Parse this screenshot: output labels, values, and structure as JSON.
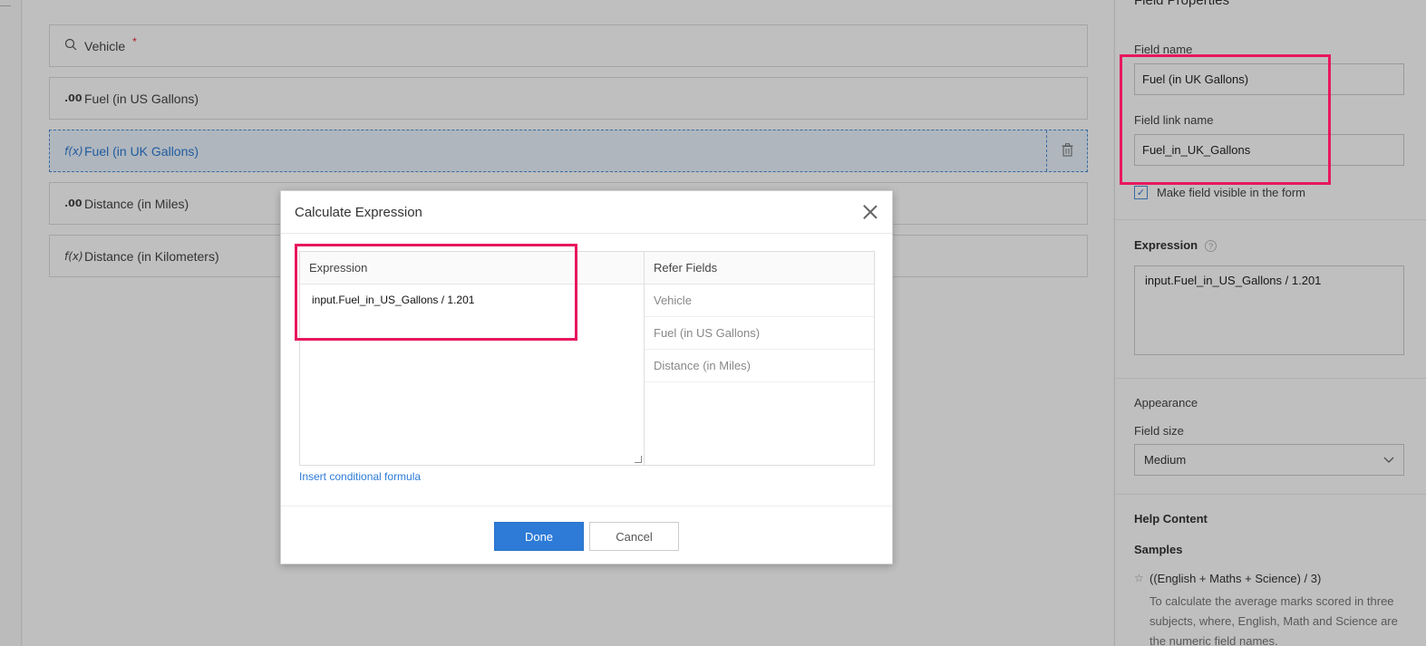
{
  "form_fields": [
    {
      "label": "Vehicle",
      "icon": "search-icon",
      "required_mark": "*"
    },
    {
      "label": "Fuel (in US Gallons)",
      "icon": "decimal-icon",
      "icon_text": ".00"
    },
    {
      "label": "Fuel (in UK Gallons)",
      "icon": "formula-icon",
      "icon_text": "f(x)",
      "selected": true
    },
    {
      "label": "Distance (in Miles)",
      "icon": "decimal-icon",
      "icon_text": ".00"
    },
    {
      "label": "Distance (in Kilometers)",
      "icon": "formula-icon",
      "icon_text": "f(x)"
    }
  ],
  "panel": {
    "title": "Field Properties",
    "field_name_label": "Field name",
    "field_name_value": "Fuel (in UK Gallons)",
    "field_link_label": "Field link name",
    "field_link_value": "Fuel_in_UK_Gallons",
    "visible_label": "Make field visible in the form",
    "expression_label": "Expression",
    "expression_value": "input.Fuel_in_US_Gallons / 1.201",
    "appearance_label": "Appearance",
    "field_size_label": "Field size",
    "field_size_value": "Medium",
    "help_label": "Help Content",
    "samples_label": "Samples",
    "sample_formula": "((English + Maths + Science) / 3)",
    "sample_desc": "To calculate the average marks scored in three subjects, where, English, Math and Science are the numeric field names."
  },
  "modal": {
    "title": "Calculate Expression",
    "expression_head": "Expression",
    "expression_value": "input.Fuel_in_US_Gallons / 1.201",
    "refer_head": "Refer Fields",
    "refer_fields": [
      "Vehicle",
      "Fuel (in US Gallons)",
      "Distance (in Miles)"
    ],
    "insert_link": "Insert conditional formula",
    "done_label": "Done",
    "cancel_label": "Cancel"
  },
  "colors": {
    "accent": "#2d7bd6",
    "highlight": "#e8175d"
  }
}
